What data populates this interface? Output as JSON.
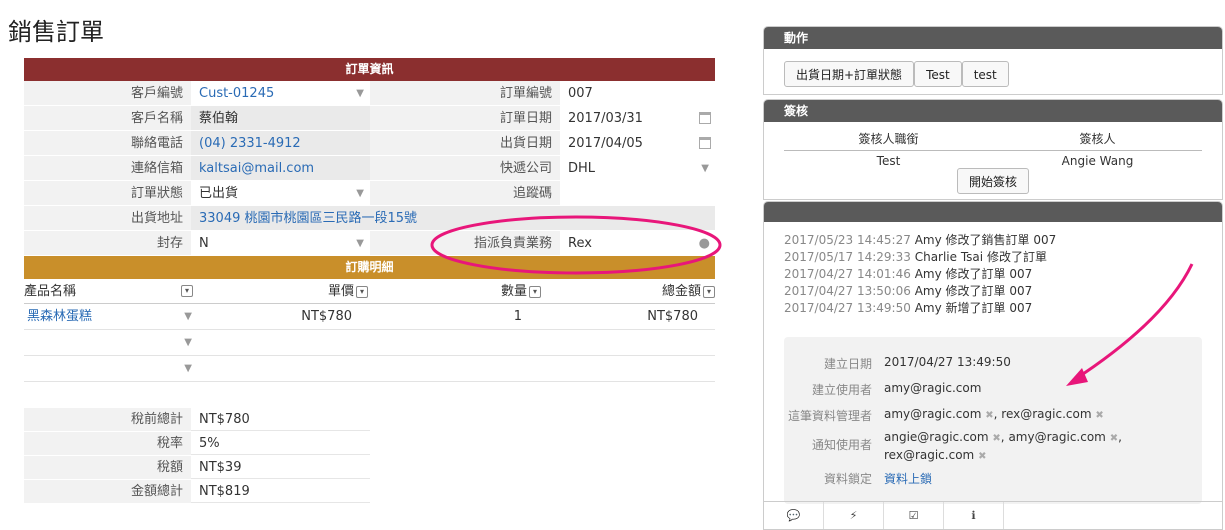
{
  "page_title": "銷售訂單",
  "section_order_info": "訂單資訊",
  "fields": {
    "customer_id_label": "客戶編號",
    "customer_id": "Cust-01245",
    "order_no_label": "訂單編號",
    "order_no": "007",
    "customer_name_label": "客戶名稱",
    "customer_name": "蔡伯翰",
    "order_date_label": "訂單日期",
    "order_date": "2017/03/31",
    "phone_label": "聯絡電話",
    "phone": "(04) 2331-4912",
    "ship_date_label": "出貨日期",
    "ship_date": "2017/04/05",
    "email_label": "連絡信箱",
    "email": "kaltsai@mail.com",
    "courier_label": "快遞公司",
    "courier": "DHL",
    "status_label": "訂單狀態",
    "status": "已出貨",
    "tracking_label": "追蹤碼",
    "tracking": "",
    "address_label": "出貨地址",
    "address": "33049 桃園市桃園區三民路一段15號",
    "archive_label": "封存",
    "archive": "N",
    "assignee_label": "指派負責業務",
    "assignee": "Rex"
  },
  "section_details": "訂購明細",
  "details": {
    "headers": [
      "產品名稱",
      "單價",
      "數量",
      "總金額"
    ],
    "rows": [
      {
        "product": "黑森林蛋糕",
        "price": "NT$780",
        "qty": "1",
        "total": "NT$780"
      }
    ]
  },
  "totals": {
    "subtotal_label": "稅前總計",
    "subtotal": "NT$780",
    "tax_rate_label": "稅率",
    "tax_rate": "5%",
    "tax_label": "稅額",
    "tax": "NT$39",
    "grand_label": "金額總計",
    "grand": "NT$819"
  },
  "actions": {
    "title": "動作",
    "buttons": [
      "出貨日期+訂單狀態",
      "Test",
      "test"
    ]
  },
  "approval": {
    "title": "簽核",
    "col_role": "簽核人職銜",
    "col_person": "簽核人",
    "role": "Test",
    "person": "Angie Wang",
    "start_button": "開始簽核"
  },
  "activity": {
    "entries": [
      {
        "ts": "2017/05/23 14:45:27",
        "text": "Amy 修改了銷售訂單 007"
      },
      {
        "ts": "2017/05/17 14:29:33",
        "text": "Charlie Tsai 修改了訂單"
      },
      {
        "ts": "2017/04/27 14:01:46",
        "text": "Amy 修改了訂單 007"
      },
      {
        "ts": "2017/04/27 13:50:06",
        "text": "Amy 修改了訂單 007"
      },
      {
        "ts": "2017/04/27 13:49:50",
        "text": "Amy 新增了訂單 007"
      }
    ],
    "meta": {
      "created_label": "建立日期",
      "created": "2017/04/27 13:49:50",
      "creator_label": "建立使用者",
      "creator": "amy@ragic.com",
      "managers_label": "這筆資料管理者",
      "manager1": "amy@ragic.com",
      "manager2": "rex@ragic.com",
      "notify_label": "通知使用者",
      "notify1": "angie@ragic.com",
      "notify2": "amy@ragic.com",
      "notify3": "rex@ragic.com",
      "lock_label": "資料鎖定",
      "lock": "資料上鎖"
    }
  },
  "colors": {
    "header_red": "#8b2f2f",
    "header_gold": "#c98f2a",
    "highlight": "#e8167a",
    "link": "#2a6bb5"
  }
}
